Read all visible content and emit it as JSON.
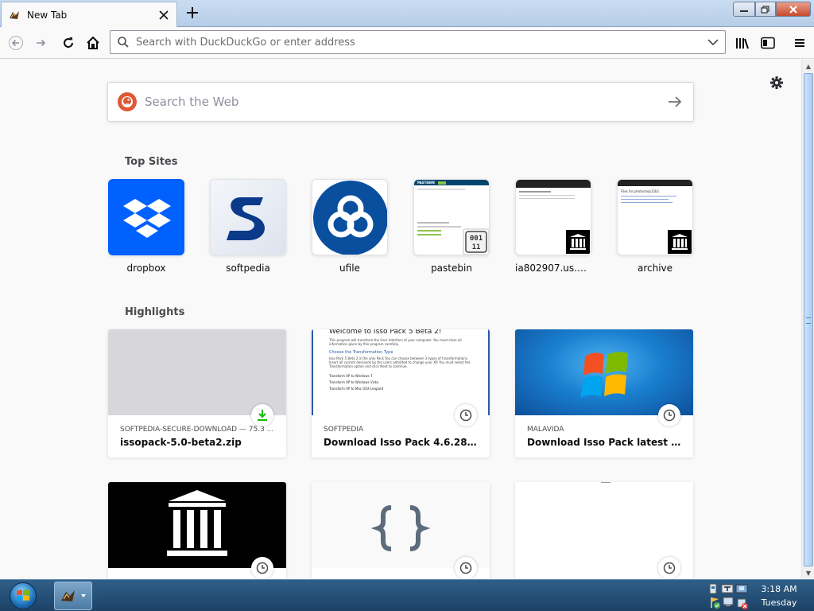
{
  "browser": {
    "tab": {
      "title": "New Tab"
    },
    "urlbar": {
      "placeholder": "Search with DuckDuckGo or enter address"
    }
  },
  "newtab": {
    "web_search": {
      "placeholder": "Search the Web"
    },
    "top_sites": {
      "heading": "Top Sites",
      "items": [
        {
          "label": "dropbox"
        },
        {
          "label": "softpedia"
        },
        {
          "label": "ufile"
        },
        {
          "label": "pastebin"
        },
        {
          "label": "ia802907.us.arch..."
        },
        {
          "label": "archive"
        }
      ]
    },
    "highlights": {
      "heading": "Highlights",
      "items": [
        {
          "source": "SOFTPEDIA-SECURE-DOWNLOAD — 75.3 ...",
          "title": "issopack-5.0-beta2.zip",
          "badge": "download-icon"
        },
        {
          "source": "SOFTPEDIA",
          "title": "Download Isso Pack 4.6.2808.15...",
          "badge": "clock-icon",
          "thumb_text": {
            "heading": "Welcome to Isso Pack 5 Beta 2!",
            "intro": "This program will transform the User Interface of your computer. You must close all information given by this program carefully.",
            "subheading": "Choose the Transformation Type",
            "body": "Isso Pack 5 Beta 2 is the only Pack You can choose between 3 types of transformations. Insert all current demands by the users admitted to change your XP. You must select the Transformation option and click Next to continue.",
            "options": [
              "Transform XP to Windows 7",
              "Transform XP to Windows Vista",
              "Transform XP to Mac OSX Leopard"
            ]
          }
        },
        {
          "source": "MALAVIDA",
          "title": "Download Isso Pack latest versio...",
          "badge": "clock-icon"
        },
        {
          "source": "",
          "title": "",
          "badge": "clock-icon"
        },
        {
          "source": "",
          "title": "",
          "badge": "clock-icon"
        },
        {
          "source": "",
          "title": "",
          "badge": "clock-icon"
        }
      ]
    },
    "tile_thumb_text": {
      "pastebin_header": "PASTEBIN",
      "pastebin_badge": "001\n11",
      "archive_heading": "Files for photoshop12b1"
    }
  },
  "taskbar": {
    "clock": {
      "time": "3:18 AM",
      "day": "Tuesday"
    }
  },
  "colors": {
    "dropbox": "#0061fe",
    "ufile": "#0a4f9e",
    "softpedia": "#0b3a8a",
    "ddg": "#de5833",
    "download_green": "#12bc00"
  }
}
